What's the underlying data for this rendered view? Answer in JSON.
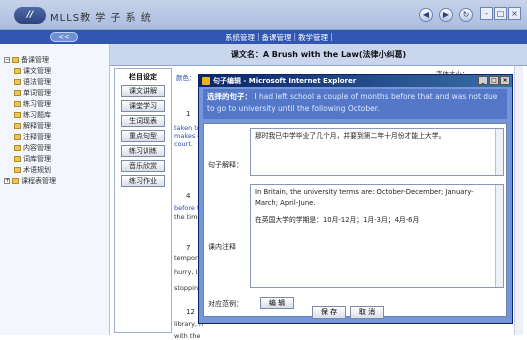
{
  "app": {
    "logo_text": "//",
    "title": "MLLS教 学 子 系 统",
    "nav_icons": [
      "back-icon",
      "forward-icon",
      "refresh-icon"
    ],
    "window_controls": [
      "-",
      "□",
      "×"
    ]
  },
  "menubar": {
    "collapse_label": "<<",
    "items": [
      "系统管理",
      "备课管理",
      "教学管理"
    ],
    "separator": "|"
  },
  "sidebar": {
    "root_label": "备课管理",
    "items": [
      "课文管理",
      "语法管理",
      "单词管理",
      "练习管理",
      "练习题库",
      "解释管理",
      "注释管理",
      "内容管理",
      "词库管理",
      "术语规划"
    ],
    "extra_label": "课程表管理"
  },
  "main": {
    "course_title": "课文名：A Brush with the Law(法律小纠葛)",
    "font_label": "字体大小：",
    "left_panel": {
      "title": "栏目设定",
      "buttons": [
        "课文讲解",
        "课堂学习",
        "生词现表",
        "重点句型",
        "练习训练",
        "音乐欣赏",
        "练习作业"
      ]
    },
    "para_numbers": [
      "1",
      "4",
      "7",
      "12"
    ],
    "snippets": {
      "s1": "taken to c",
      "s2": "makes d",
      "s3": "court.",
      "s4": "before th",
      "s5": "the time.",
      "s6": "temporar",
      "s7": "hurry, I v",
      "s8": "stopping",
      "s9": "library, h",
      "s10": "with the",
      "color_label": "颜色："
    }
  },
  "dialog": {
    "title": "句子编辑 - Microsoft Internet Explorer",
    "controls": [
      "_",
      "□",
      "×"
    ],
    "sentence_label": "选择的句子：",
    "sentence_text": "I had left school a couple of months before that and was not due to go to university until the following October.",
    "analysis_label": "句子解释：",
    "analysis_text": "那时我已中学毕业了几个月，并要到第二年十月份才能上大学。",
    "notes_label": "课内注释",
    "notes_line1": "In Britain, the university terms are: October-December; January-March; April-June.",
    "notes_line2": "在英国大学的学期是：10月-12月；1月-3月；4月-6月",
    "scope_label": "对应范例：",
    "edit_button": "编 辑",
    "save_button": "保 存",
    "cancel_button": "取 消"
  }
}
